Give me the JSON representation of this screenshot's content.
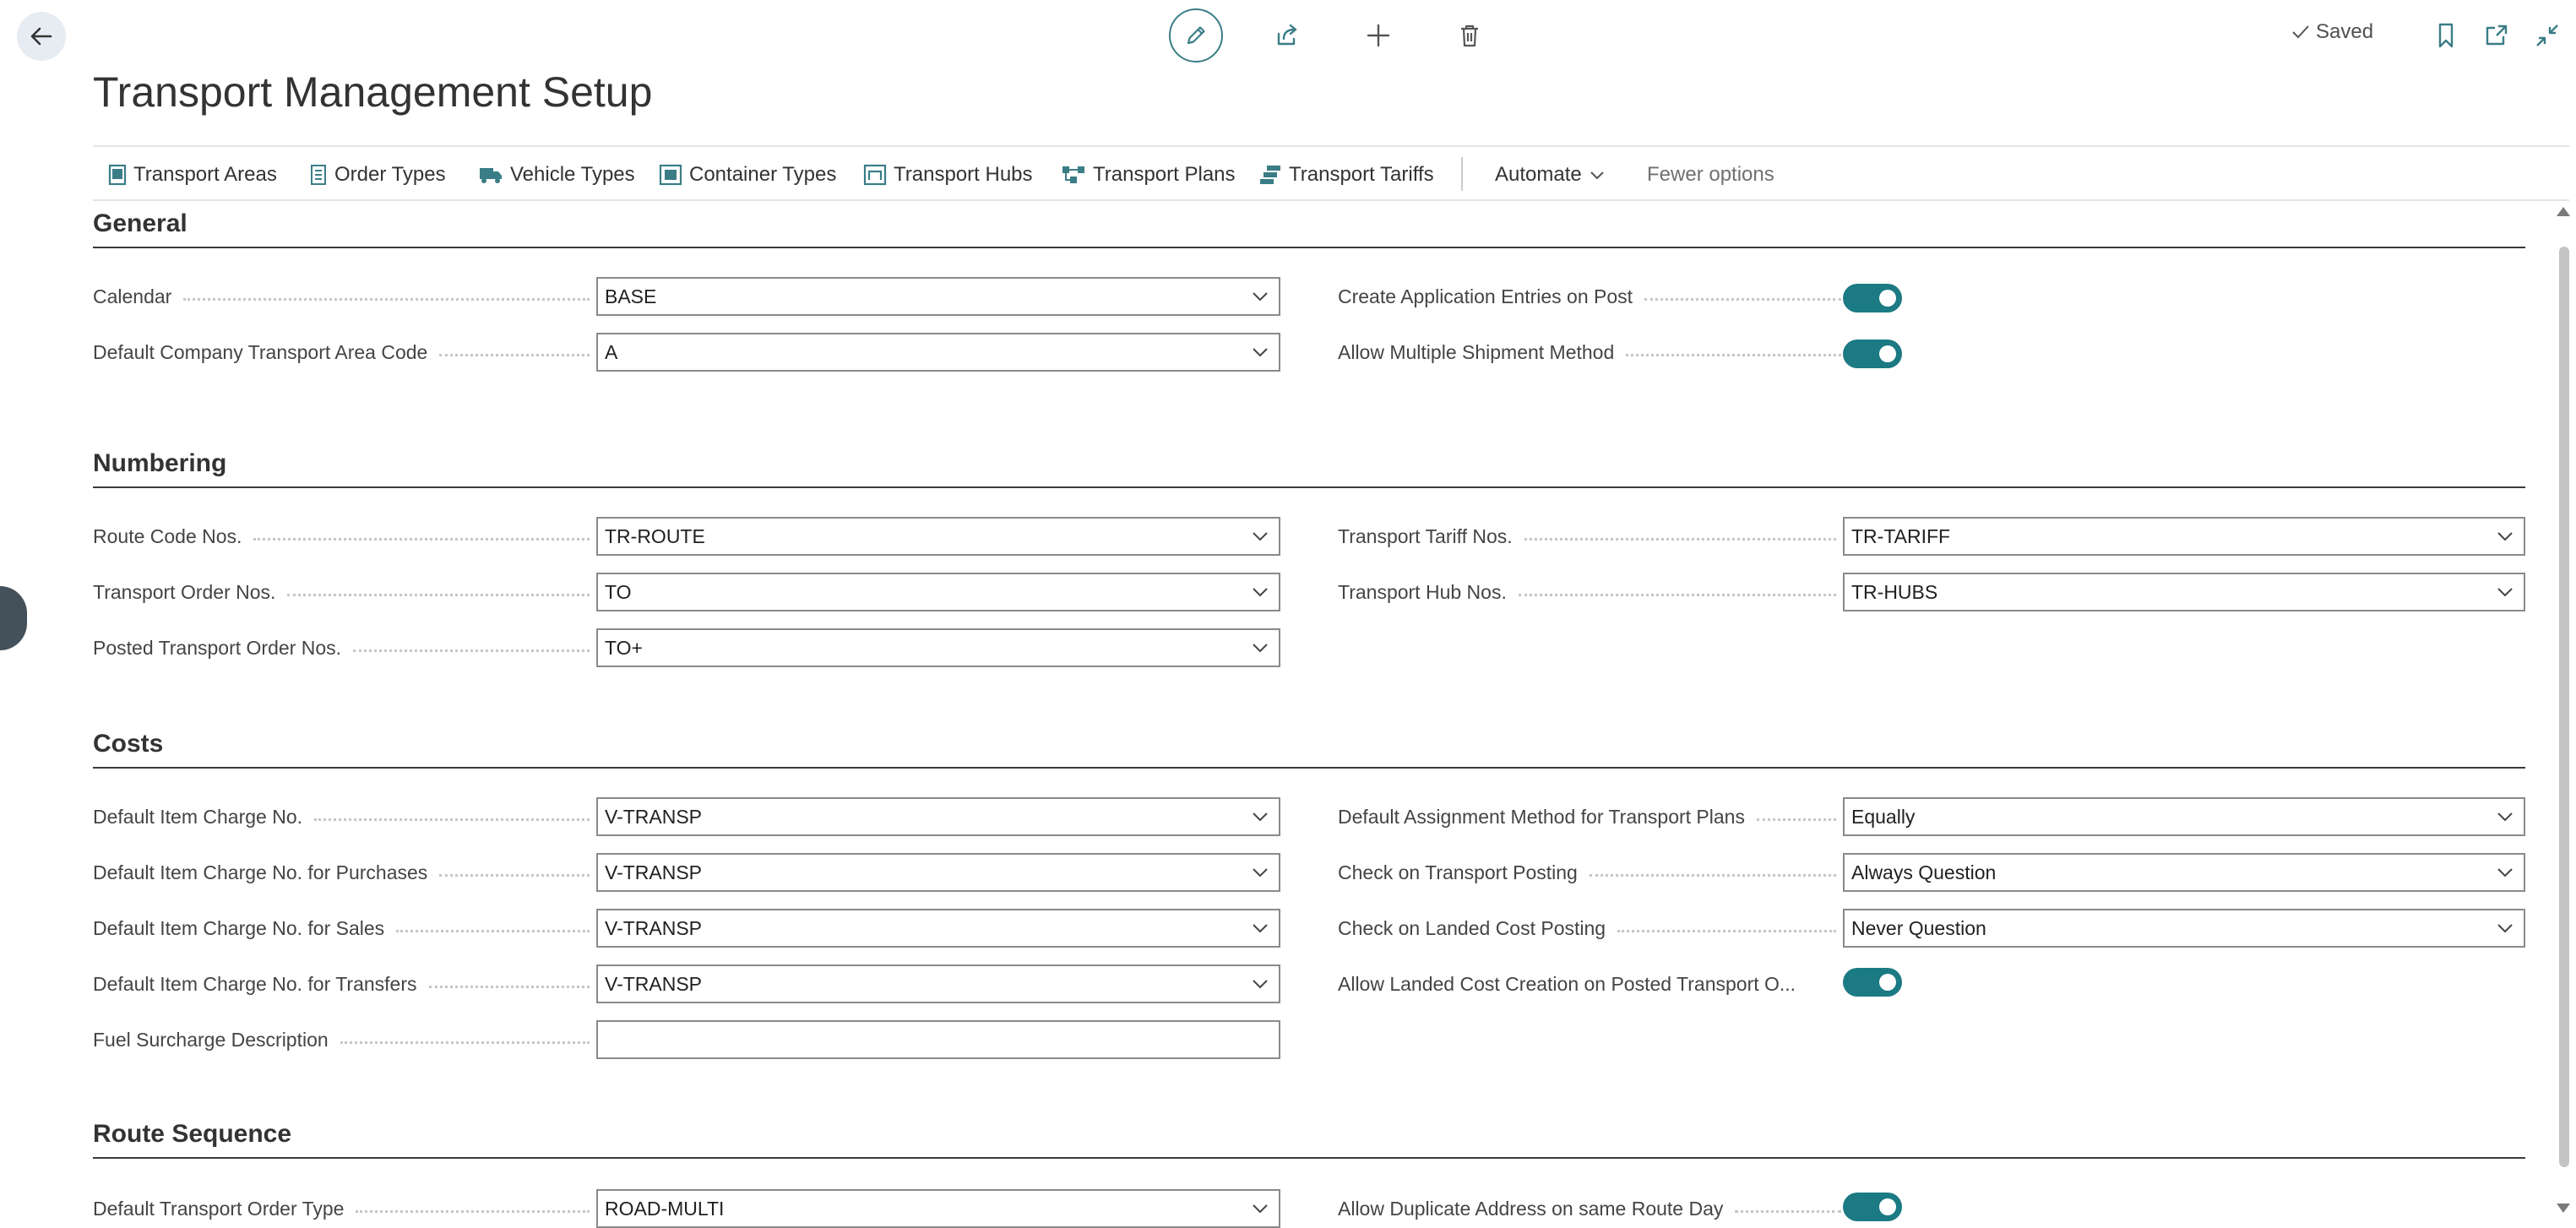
{
  "page": {
    "title": "Transport Management Setup",
    "saved_label": "Saved"
  },
  "top_icons": [
    "back-arrow-icon",
    "edit-pencil-icon",
    "share-icon",
    "new-plus-icon",
    "delete-trash-icon",
    "bookmark-icon",
    "open-new-window-icon",
    "collapse-icon"
  ],
  "actions": {
    "transport_areas": "Transport Areas",
    "order_types": "Order Types",
    "vehicle_types": "Vehicle Types",
    "container_types": "Container Types",
    "transport_hubs": "Transport Hubs",
    "transport_plans": "Transport Plans",
    "transport_tariffs": "Transport Tariffs",
    "automate": "Automate",
    "fewer_options": "Fewer options"
  },
  "general": {
    "title": "General",
    "calendar": {
      "label": "Calendar",
      "value": "BASE"
    },
    "default_area": {
      "label": "Default Company Transport Area Code",
      "value": "A"
    },
    "create_entries": {
      "label": "Create Application Entries on Post",
      "value": true
    },
    "allow_multiple": {
      "label": "Allow Multiple Shipment Method",
      "value": true
    }
  },
  "numbering": {
    "title": "Numbering",
    "route_code": {
      "label": "Route Code Nos.",
      "value": "TR-ROUTE"
    },
    "transport_order": {
      "label": "Transport Order Nos.",
      "value": "TO"
    },
    "posted_order": {
      "label": "Posted Transport Order Nos.",
      "value": "TO+"
    },
    "tariff": {
      "label": "Transport Tariff Nos.",
      "value": "TR-TARIFF"
    },
    "hub": {
      "label": "Transport Hub Nos.",
      "value": "TR-HUBS"
    }
  },
  "costs": {
    "title": "Costs",
    "item_charge": {
      "label": "Default Item Charge No.",
      "value": "V-TRANSP"
    },
    "item_charge_purchases": {
      "label": "Default Item Charge No. for Purchases",
      "value": "V-TRANSP"
    },
    "item_charge_sales": {
      "label": "Default Item Charge No. for Sales",
      "value": "V-TRANSP"
    },
    "item_charge_transfers": {
      "label": "Default Item Charge No. for Transfers",
      "value": "V-TRANSP"
    },
    "fuel_surcharge": {
      "label": "Fuel Surcharge Description",
      "value": ""
    },
    "assignment_method": {
      "label": "Default Assignment Method for Transport Plans",
      "value": "Equally"
    },
    "check_transport": {
      "label": "Check on Transport Posting",
      "value": "Always Question"
    },
    "check_landed": {
      "label": "Check on Landed Cost Posting",
      "value": "Never Question"
    },
    "allow_landed": {
      "label": "Allow Landed Cost Creation on Posted Transport O...",
      "value": true
    }
  },
  "route_sequence": {
    "title": "Route Sequence",
    "order_type": {
      "label": "Default Transport Order Type",
      "value": "ROAD-MULTI"
    },
    "allow_duplicate": {
      "label": "Allow Duplicate Address on same Route Day",
      "value": true
    }
  },
  "colors": {
    "accent": "#1b7a83",
    "edit_ring": "#3a7d86",
    "text": "#333333",
    "dots": "#c6c6c6"
  }
}
